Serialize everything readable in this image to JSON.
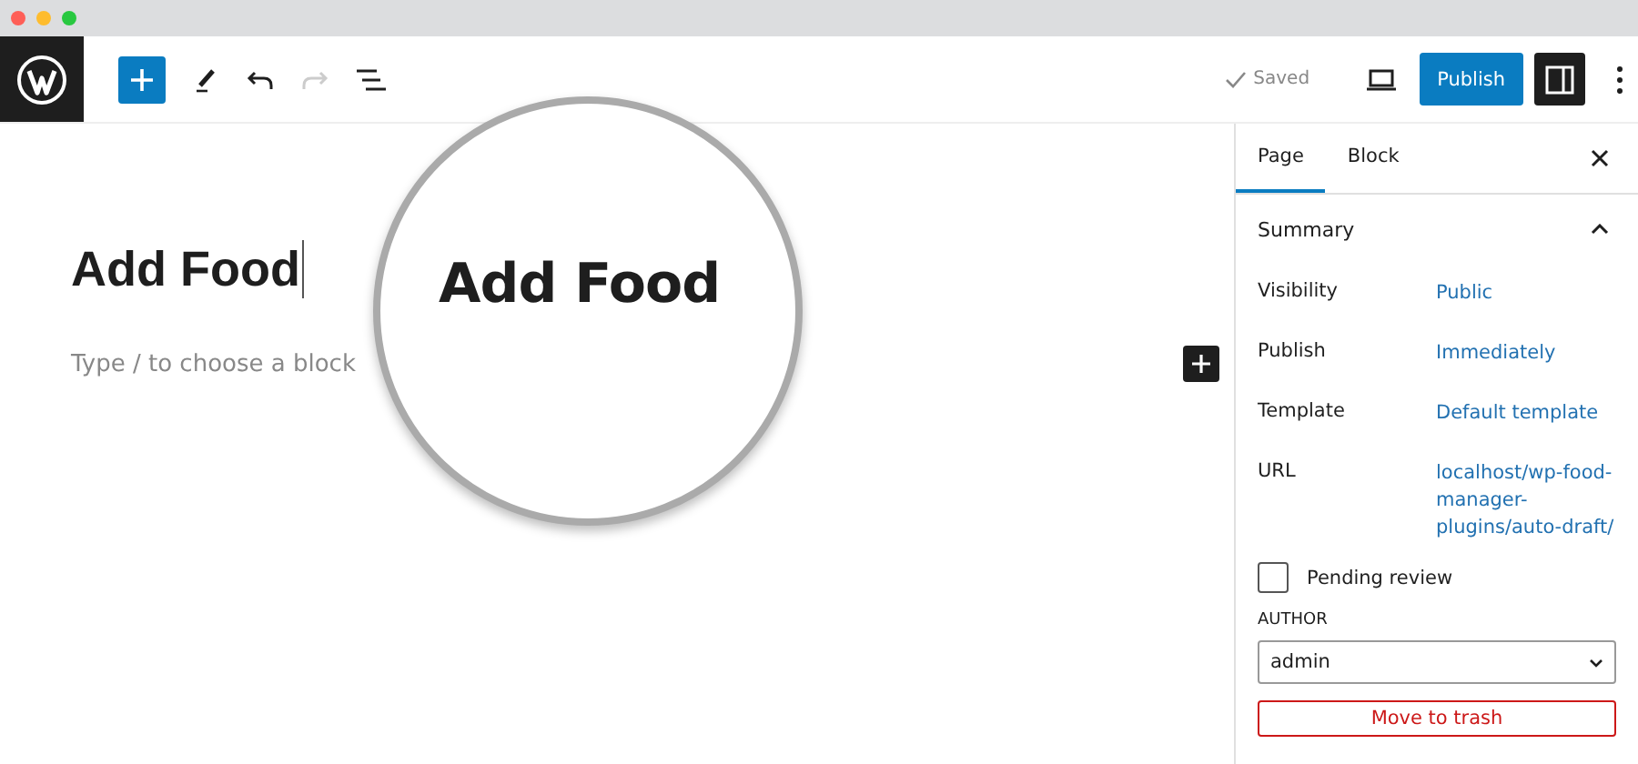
{
  "header": {
    "saved": "Saved",
    "publish": "Publish"
  },
  "editor": {
    "title": "Add Food",
    "placeholder": "Type / to choose a block"
  },
  "magnifier": {
    "text": "Add Food"
  },
  "sidebar": {
    "tabs": [
      {
        "label": "Page",
        "selected": true
      },
      {
        "label": "Block",
        "selected": false
      }
    ],
    "summary": {
      "title": "Summary",
      "expanded": true,
      "rows": [
        {
          "label": "Visibility",
          "value": "Public"
        },
        {
          "label": "Publish",
          "value": "Immediately"
        },
        {
          "label": "Template",
          "value": "Default template"
        },
        {
          "label": "URL",
          "value": "localhost/wp-food-manager-plugins/auto-draft/"
        }
      ],
      "pending_review": {
        "label": "Pending review",
        "checked": false
      },
      "author": {
        "label": "AUTHOR",
        "value": "admin"
      },
      "trash": "Move to trash"
    }
  }
}
